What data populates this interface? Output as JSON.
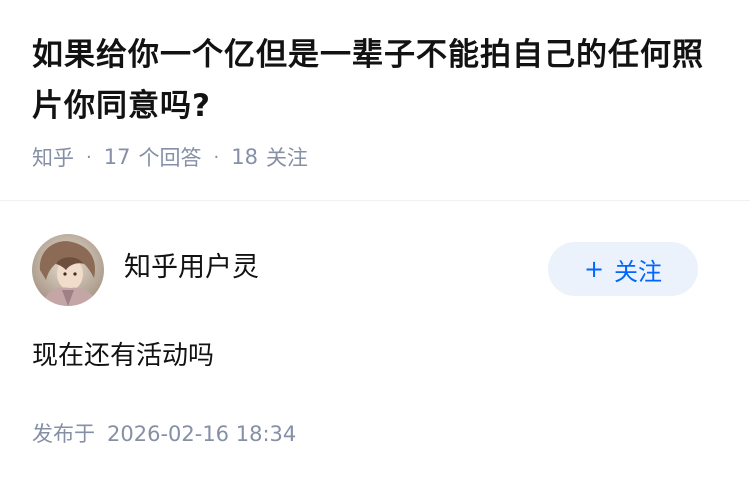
{
  "question": {
    "title": "如果给你一个亿但是一辈子不能拍自己的任何照片你同意吗?",
    "source": "知乎",
    "answer_count": "17",
    "answer_label": "个回答",
    "follow_count": "18",
    "follow_label": "关注",
    "separator": "·"
  },
  "answer": {
    "author": {
      "name": "知乎用户灵",
      "avatar_icon": "avatar-icon"
    },
    "follow_button": {
      "icon": "plus-icon",
      "plus": "+",
      "label": "关注"
    },
    "content": "现在还有活动吗",
    "published_label": "发布于",
    "published_time": "2026-02-16 18:34"
  },
  "colors": {
    "title": "#121212",
    "meta": "#8590a6",
    "accent": "#0066ff",
    "button_bg": "#ebf2fb",
    "divider": "#f0f1f3"
  }
}
